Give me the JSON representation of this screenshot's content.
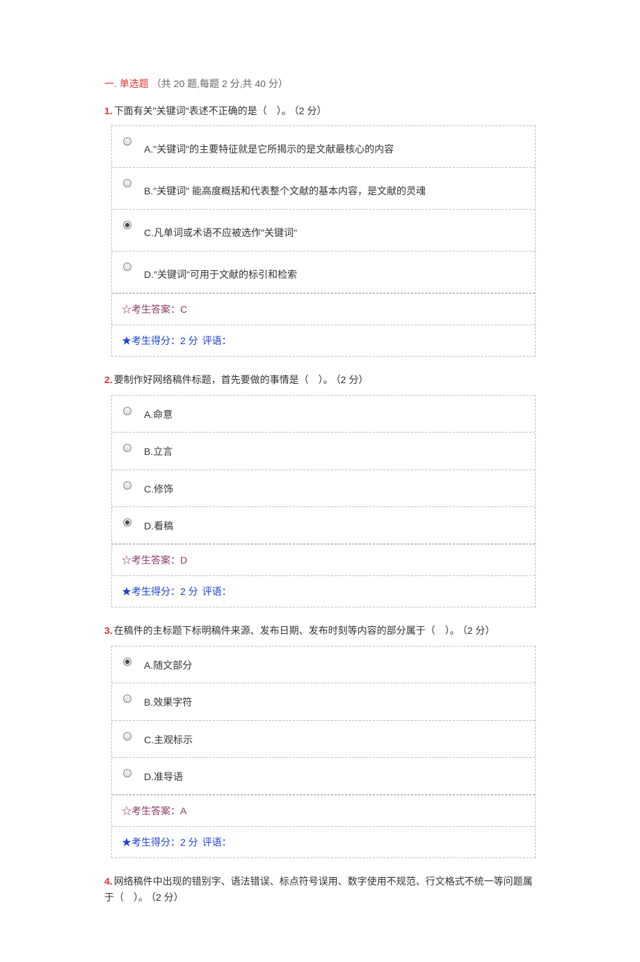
{
  "section": {
    "num": "一.",
    "title": "单选题",
    "info": "（共 20 题,每题 2 分,共 40 分）"
  },
  "questions": [
    {
      "num": "1.",
      "text": "下面有关\"关键词\"表述不正确的是（　）。",
      "points": "（2 分）",
      "options": [
        {
          "label": "A.\"关键词\"的主要特征就是它所揭示的是文献最核心的内容",
          "selected": false,
          "tall": true
        },
        {
          "label": "B.\"关键词\" 能高度概括和代表整个文献的基本内容，是文献的灵魂",
          "selected": false,
          "tall": true
        },
        {
          "label": "C.凡单词或术语不应被选作\"关键词\"",
          "selected": true,
          "tall": true
        },
        {
          "label": "D.\"关键词\"可用于文献的标引和检索",
          "selected": false,
          "tall": true
        }
      ],
      "answer_prefix": "☆考生答案：",
      "answer": "C",
      "score_prefix": "★考生得分：",
      "score": "2 分",
      "comment_prefix": "评语："
    },
    {
      "num": "2.",
      "text": "要制作好网络稿件标题，首先要做的事情是（　）。",
      "points": "（2 分）",
      "options": [
        {
          "label": "A.命意",
          "selected": false,
          "tall": false
        },
        {
          "label": "B.立言",
          "selected": false,
          "tall": false
        },
        {
          "label": "C.修饰",
          "selected": false,
          "tall": false
        },
        {
          "label": "D.看稿",
          "selected": true,
          "tall": false
        }
      ],
      "answer_prefix": "☆考生答案：",
      "answer": "D",
      "score_prefix": "★考生得分：",
      "score": "2 分",
      "comment_prefix": "评语："
    },
    {
      "num": "3.",
      "text": "在稿件的主标题下标明稿件来源、发布日期、发布时刻等内容的部分属于（　）。",
      "points": "（2 分）",
      "options": [
        {
          "label": "A.随文部分",
          "selected": true,
          "tall": false
        },
        {
          "label": "B.效果字符",
          "selected": false,
          "tall": false
        },
        {
          "label": "C.主观标示",
          "selected": false,
          "tall": false
        },
        {
          "label": "D.准导语",
          "selected": false,
          "tall": false
        }
      ],
      "answer_prefix": "☆考生答案：",
      "answer": "A",
      "score_prefix": "★考生得分：",
      "score": "2 分",
      "comment_prefix": "评语："
    },
    {
      "num": "4.",
      "text": "网络稿件中出现的错别字、语法错误、标点符号误用、数字使用不规范、行文格式不统一等问题属于（　）。",
      "points": "（2 分）",
      "options": [],
      "answer_prefix": "",
      "answer": "",
      "score_prefix": "",
      "score": "",
      "comment_prefix": ""
    }
  ]
}
